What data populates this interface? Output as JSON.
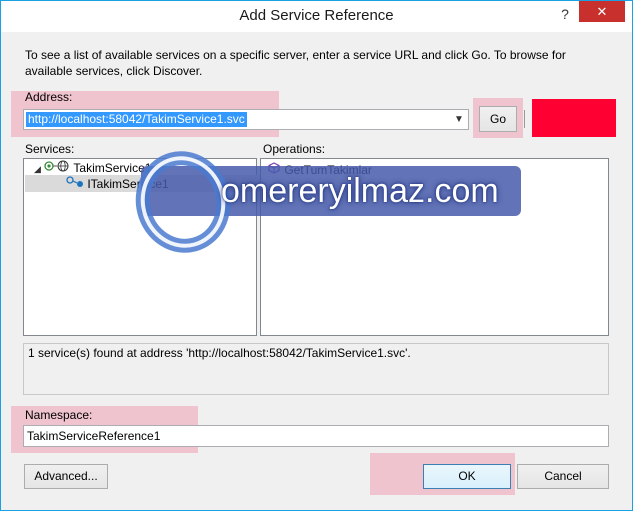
{
  "window": {
    "title": "Add Service Reference",
    "help_glyph": "?",
    "close_glyph": "✕"
  },
  "description": "To see a list of available services on a specific server, enter a service URL and click Go. To browse for available services, click Discover.",
  "address": {
    "label": "Address:",
    "value": "http://localhost:58042/TakimService1.svc",
    "go_label": "Go"
  },
  "services": {
    "label": "Services:",
    "tree": [
      {
        "label": "TakimService1"
      },
      {
        "label": "ITakimService1"
      }
    ]
  },
  "operations": {
    "label": "Operations:",
    "items": [
      {
        "label": "GetTumTakimlar"
      }
    ]
  },
  "status_text": "1 service(s) found at address 'http://localhost:58042/TakimService1.svc'.",
  "namespace": {
    "label": "Namespace:",
    "value": "TakimServiceReference1"
  },
  "buttons": {
    "advanced": "Advanced...",
    "ok": "OK",
    "cancel": "Cancel"
  },
  "watermark": {
    "text": "omereryilmaz.com",
    "logo_letter": "e"
  },
  "colors": {
    "highlight": "#eea0b4",
    "selection": "#3399ff",
    "red_block": "#ff0033",
    "close": "#c7302c"
  }
}
